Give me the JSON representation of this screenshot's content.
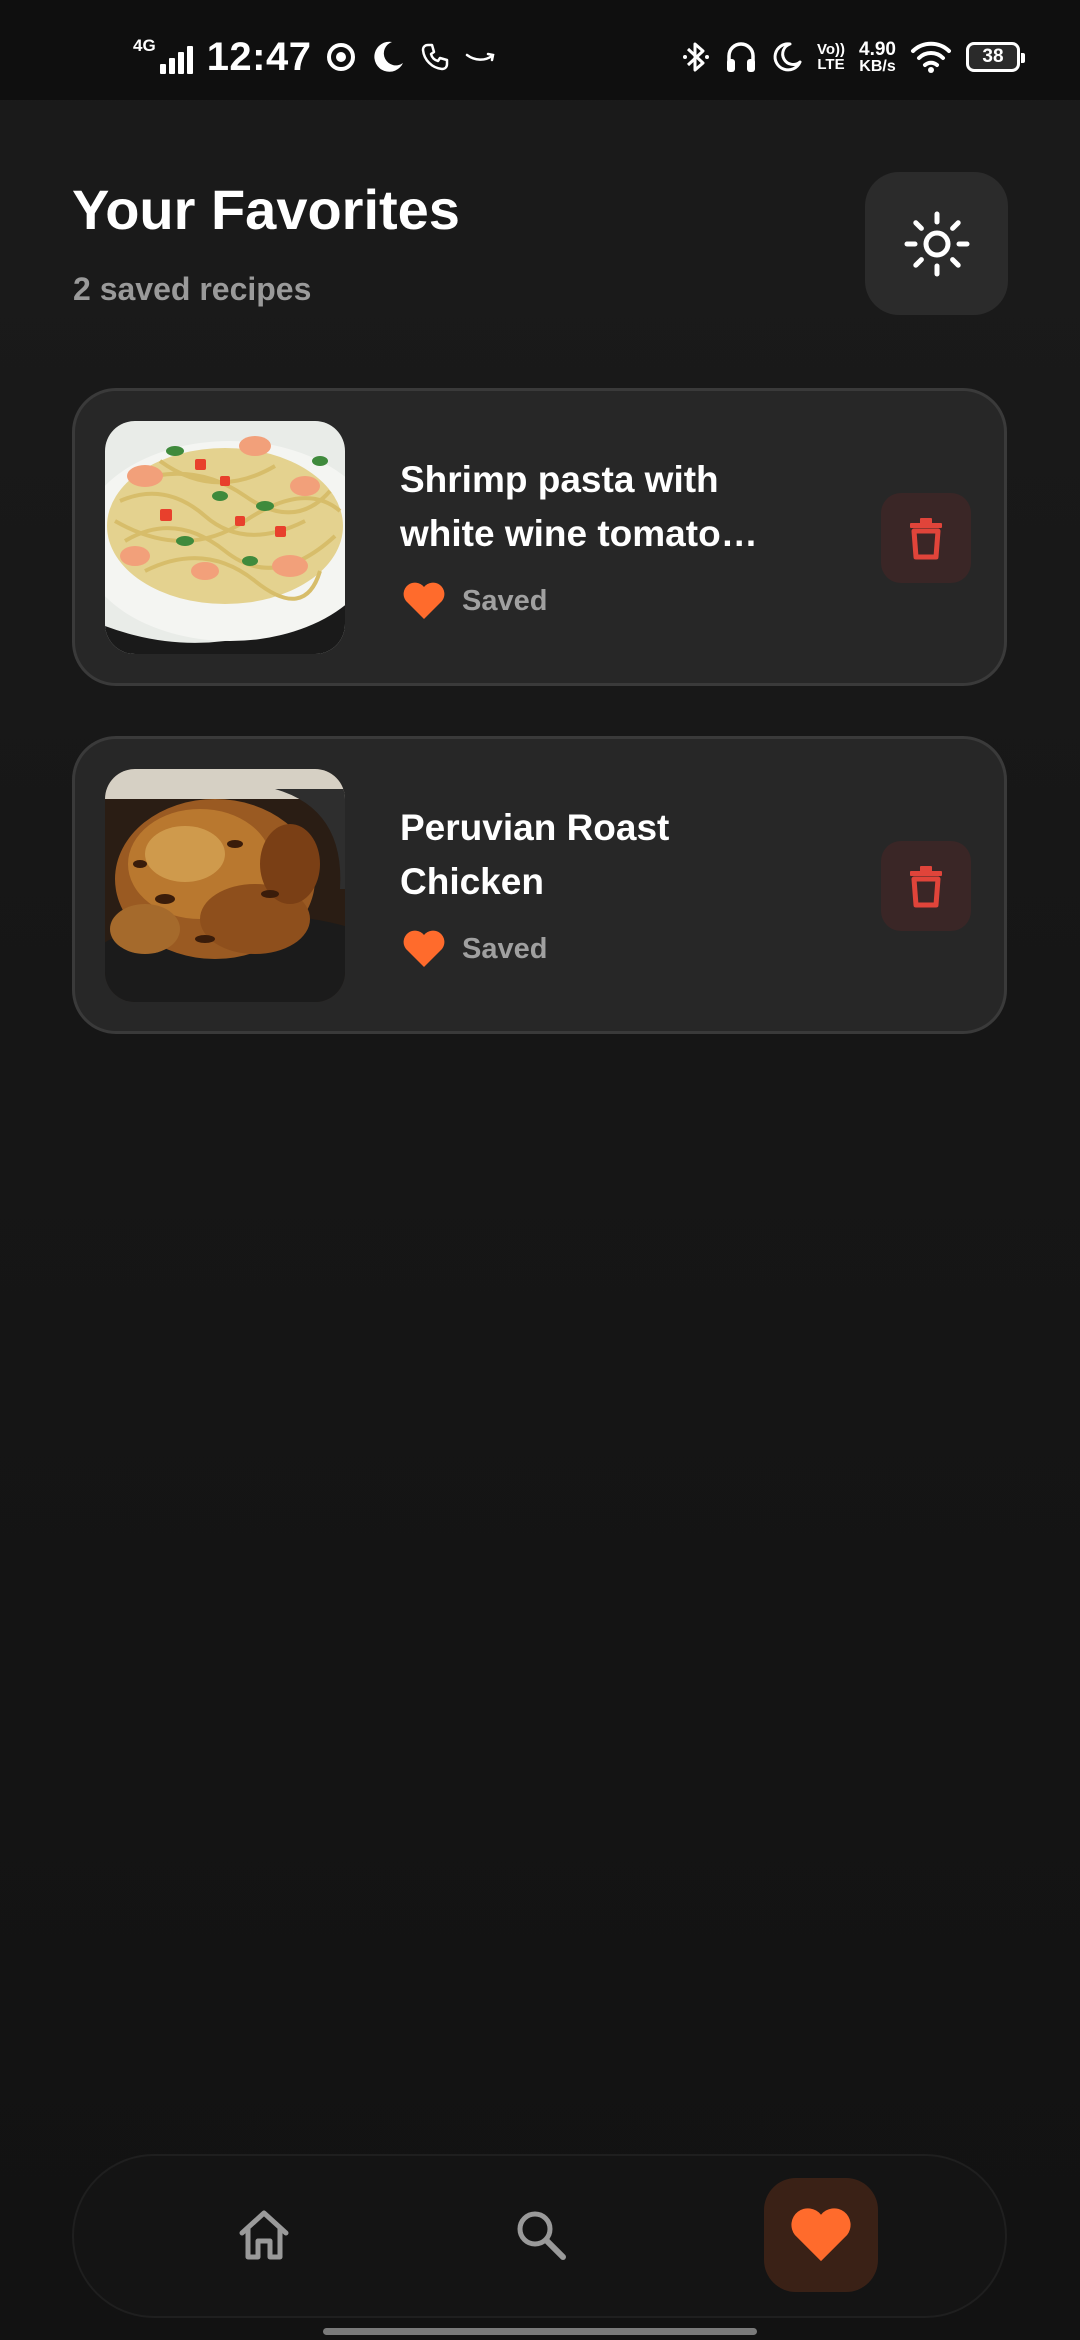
{
  "status_bar": {
    "network_type": "4G",
    "time": "12:47",
    "volte_top": "Vo))",
    "volte_bottom": "LTE",
    "net_speed_value": "4.90",
    "net_speed_unit": "KB/s",
    "battery_level": "38",
    "left_icons": [
      "signal-icon",
      "target-icon",
      "moon-icon",
      "phone-icon",
      "amazon-icon"
    ],
    "right_icons": [
      "bluetooth-icon",
      "headphones-icon",
      "moon-icon",
      "volte-icon",
      "wifi-icon",
      "battery-icon"
    ]
  },
  "header": {
    "title": "Your Favorites",
    "subtitle": "2 saved recipes",
    "theme_toggle_icon": "sun-icon"
  },
  "favorites": [
    {
      "title": "Shrimp pasta with white wine tomato sauce",
      "saved_label": "Saved",
      "image": "shrimp-pasta-photo"
    },
    {
      "title": "Peruvian Roast Chicken",
      "saved_label": "Saved",
      "image": "roast-chicken-photo"
    }
  ],
  "bottom_nav": {
    "items": [
      {
        "icon": "home-icon",
        "active": false
      },
      {
        "icon": "search-icon",
        "active": false
      },
      {
        "icon": "heart-icon",
        "active": true
      }
    ]
  },
  "colors": {
    "accent": "#ff6b2c",
    "delete_red": "#e0443a",
    "background": "#161616",
    "card": "#272727"
  }
}
